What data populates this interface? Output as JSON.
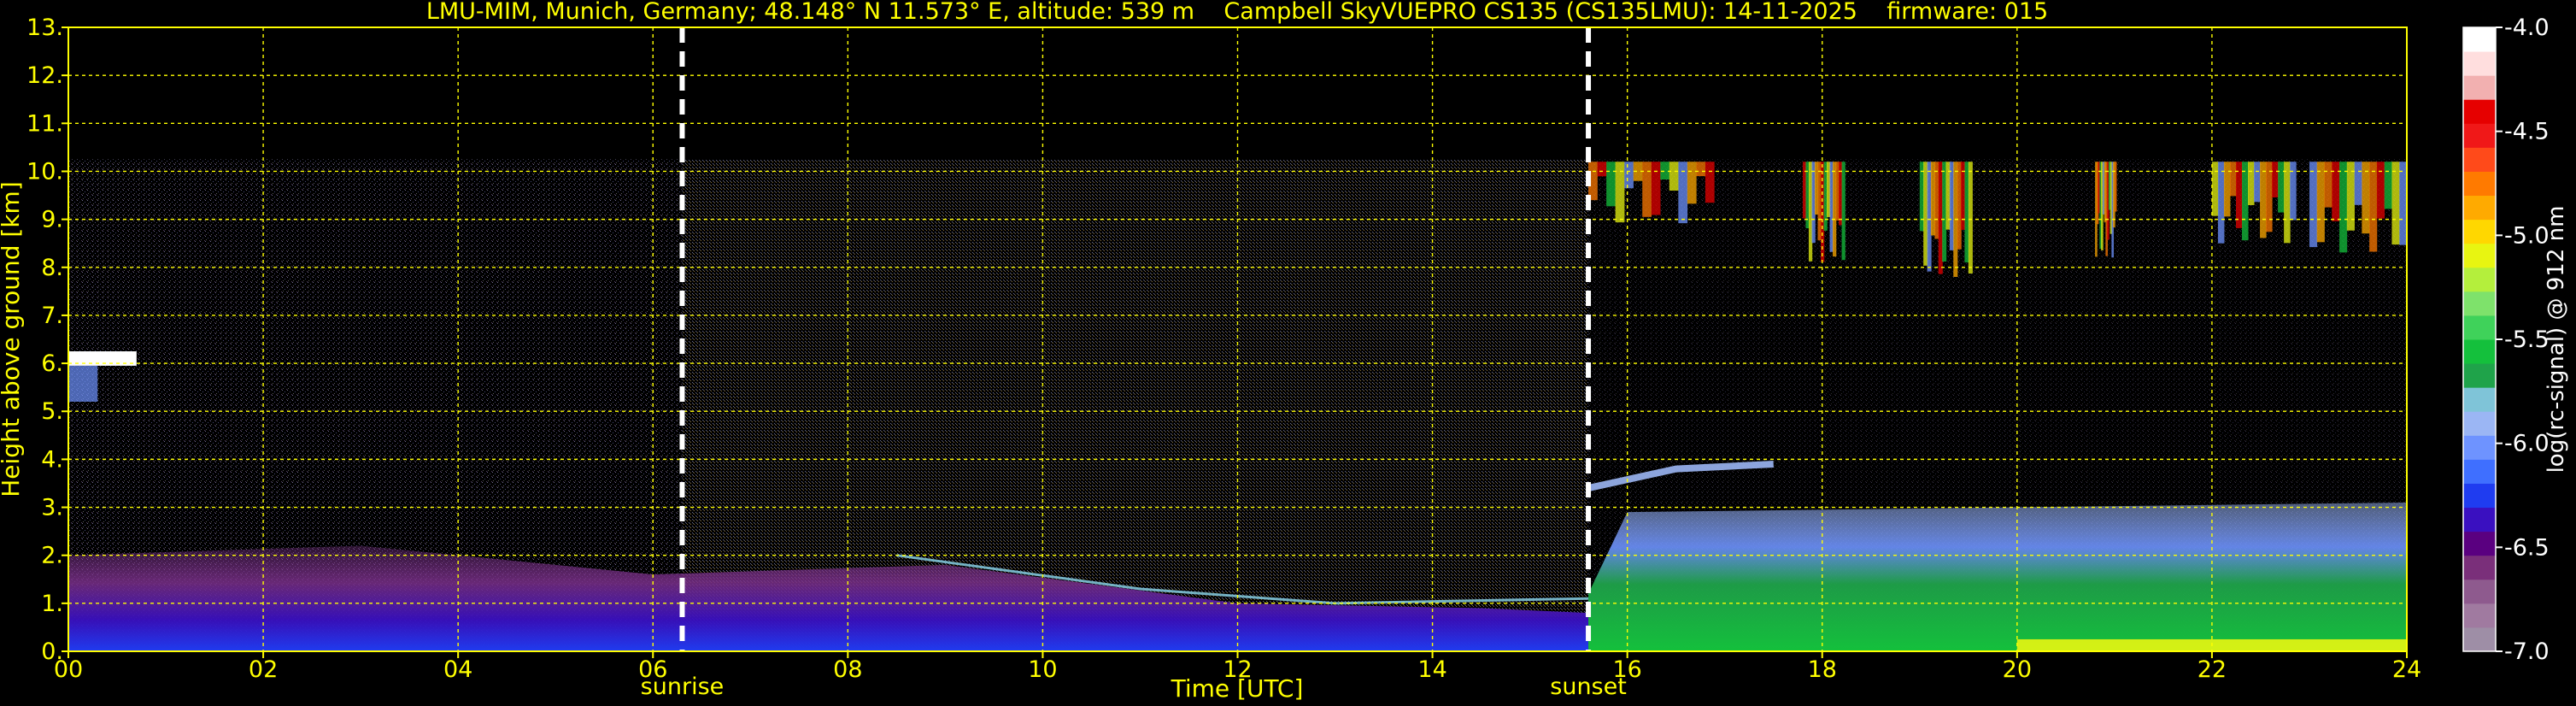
{
  "title": "LMU-MIM, Munich, Germany; 48.148° N 11.573° E, altitude: 539 m    Campbell SkyVUEPRO CS135 (CS135LMU): 14-11-2025    firmware: 015",
  "colors": {
    "background": "#000000",
    "axis_text": "#ffff00",
    "grid": "#ffff00",
    "marker_line": "#ffffff",
    "colorbar_label": "#ffffff"
  },
  "chart_data": {
    "type": "heatmap",
    "title": "LMU-MIM, Munich, Germany; 48.148° N 11.573° E, altitude: 539 m    Campbell SkyVUEPRO CS135 (CS135LMU): 14-11-2025    firmware: 015",
    "xlabel": "Time [UTC]",
    "ylabel": "Height above ground [km]",
    "xlim": [
      0,
      24
    ],
    "ylim": [
      0,
      13
    ],
    "x_ticks": [
      "00",
      "02",
      "04",
      "06",
      "08",
      "10",
      "12",
      "14",
      "16",
      "18",
      "20",
      "22",
      "24"
    ],
    "x_tick_values": [
      0,
      2,
      4,
      6,
      8,
      10,
      12,
      14,
      16,
      18,
      20,
      22,
      24
    ],
    "y_ticks": [
      "0.",
      "1.",
      "2.",
      "3.",
      "4.",
      "5.",
      "6.",
      "7.",
      "8.",
      "9.",
      "10.",
      "11.",
      "12.",
      "13."
    ],
    "y_tick_values": [
      0,
      1,
      2,
      3,
      4,
      5,
      6,
      7,
      8,
      9,
      10,
      11,
      12,
      13
    ],
    "grid": true,
    "markers": [
      {
        "label": "sunrise",
        "x": 6.3
      },
      {
        "label": "sunset",
        "x": 15.6
      }
    ],
    "colorbar": {
      "label": "log(rc-signal) @ 912 nm",
      "range": [
        -7.0,
        -4.0
      ],
      "ticks": [
        "-4.0",
        "-4.5",
        "-5.0",
        "-5.5",
        "-6.0",
        "-6.5",
        "-7.0"
      ],
      "tick_values": [
        -4.0,
        -4.5,
        -5.0,
        -5.5,
        -6.0,
        -6.5,
        -7.0
      ],
      "colors": [
        "#9e8ea6",
        "#a07aa0",
        "#8e5a8e",
        "#7a2f7a",
        "#5a0080",
        "#3a10c0",
        "#1f3cf0",
        "#3f6fff",
        "#6e93ff",
        "#9bb6f4",
        "#7fc4d8",
        "#1fa34a",
        "#14c03c",
        "#3fd25a",
        "#7ee26b",
        "#b4ef3c",
        "#e8f511",
        "#ffd700",
        "#ffaa00",
        "#ff7a00",
        "#ff4a1a",
        "#f01818",
        "#e60000",
        "#f2b0b0",
        "#ffdede",
        "#ffffff"
      ]
    },
    "features": {
      "data_top_km": 10.25,
      "noise_floor": "speckled noise 0–10.25 km, densest 06–16 UTC",
      "boundary_layer_top_km": [
        {
          "x": 0,
          "y": 2.0
        },
        {
          "x": 3,
          "y": 2.2
        },
        {
          "x": 6,
          "y": 1.6
        },
        {
          "x": 9,
          "y": 1.8
        },
        {
          "x": 12,
          "y": 1.0
        },
        {
          "x": 14.5,
          "y": 0.9
        },
        {
          "x": 16,
          "y": 2.9
        },
        {
          "x": 20,
          "y": 3.0
        },
        {
          "x": 24,
          "y": 3.1
        }
      ],
      "elevated_layer_km": [
        {
          "x": 15.6,
          "y": 3.4
        },
        {
          "x": 16.5,
          "y": 3.8
        },
        {
          "x": 17.5,
          "y": 3.9
        }
      ],
      "low_cloud": {
        "x_start": 0,
        "x_end": 0.7,
        "y": 6.1
      },
      "cirrus": {
        "x_start": 15.6,
        "x_end": 24,
        "y_top": 10.2,
        "y_bottom": 8.5
      }
    }
  }
}
